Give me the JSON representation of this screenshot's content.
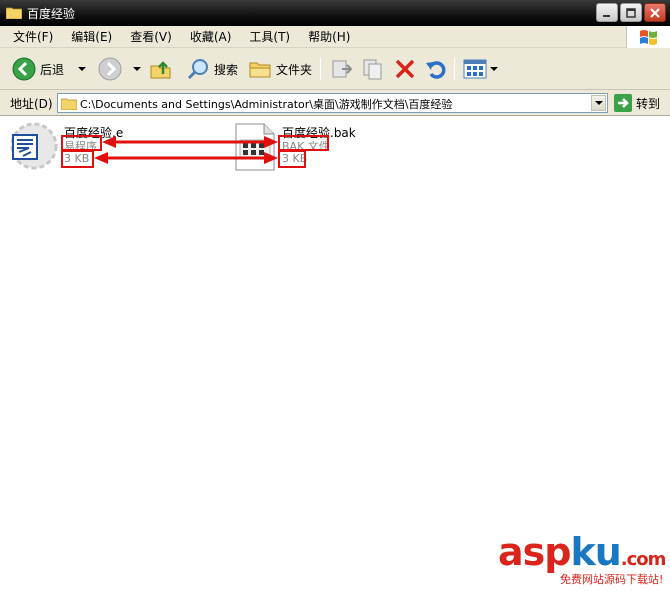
{
  "window": {
    "title": "百度经验"
  },
  "menu": [
    "文件(F)",
    "编辑(E)",
    "查看(V)",
    "收藏(A)",
    "工具(T)",
    "帮助(H)"
  ],
  "toolbar": {
    "back_label": "后退",
    "search_label": "搜索",
    "folders_label": "文件夹"
  },
  "address": {
    "label": "地址(D)",
    "path": "C:\\Documents and Settings\\Administrator\\桌面\\游戏制作文档\\百度经验",
    "go_label": "转到"
  },
  "files": [
    {
      "name": "百度经验.e",
      "type": "易程序",
      "size": "3 KB"
    },
    {
      "name": "百度经验.bak",
      "type": "BAK 文件",
      "size": "3 KB"
    }
  ],
  "watermark": {
    "main_asp": "asp",
    "main_ku": "ku",
    "main_com": ".com",
    "sub": "免费网站源码下载站!"
  },
  "colors": {
    "highlight": "#e01010",
    "titlebar": "#111111",
    "chrome": "#ece9d8"
  }
}
